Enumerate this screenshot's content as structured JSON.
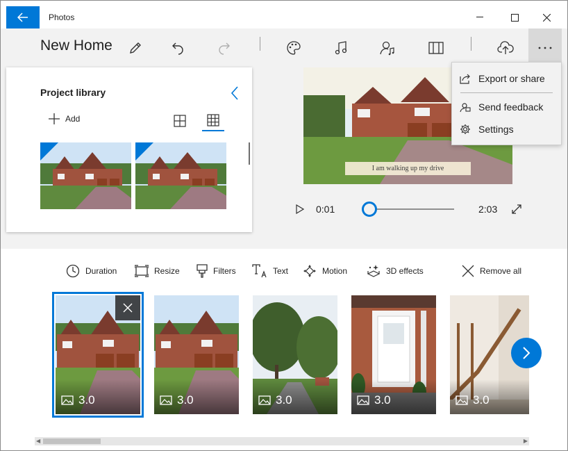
{
  "window": {
    "title": "Photos"
  },
  "toolbar": {
    "project_title": "New Home",
    "icons": [
      "pencil-icon",
      "undo-icon",
      "redo-icon",
      "palette-icon",
      "music-icon",
      "narration-icon",
      "aspect-ratio-icon",
      "upload-icon",
      "more-icon"
    ]
  },
  "menu": {
    "items": [
      {
        "label": "Export or share",
        "icon": "share-icon"
      },
      {
        "label": "Send feedback",
        "icon": "feedback-icon"
      },
      {
        "label": "Settings",
        "icon": "gear-icon"
      }
    ]
  },
  "library": {
    "title": "Project library",
    "add_label": "Add"
  },
  "preview": {
    "caption": "I am walking up my drive",
    "current_time": "0:01",
    "total_time": "2:03",
    "progress": 0.008
  },
  "storyboard": {
    "tools": [
      "Duration",
      "Resize",
      "Filters",
      "Text",
      "Motion",
      "3D effects",
      "Remove all"
    ],
    "cards": [
      {
        "duration": "3.0",
        "scene": "house",
        "selected": true
      },
      {
        "duration": "3.0",
        "scene": "house",
        "selected": false
      },
      {
        "duration": "3.0",
        "scene": "garden",
        "selected": false
      },
      {
        "duration": "3.0",
        "scene": "door",
        "selected": false
      },
      {
        "duration": "3.0",
        "scene": "stairs",
        "selected": false
      }
    ]
  },
  "colors": {
    "accent": "#0078d7",
    "background": "#f2f2f2"
  }
}
